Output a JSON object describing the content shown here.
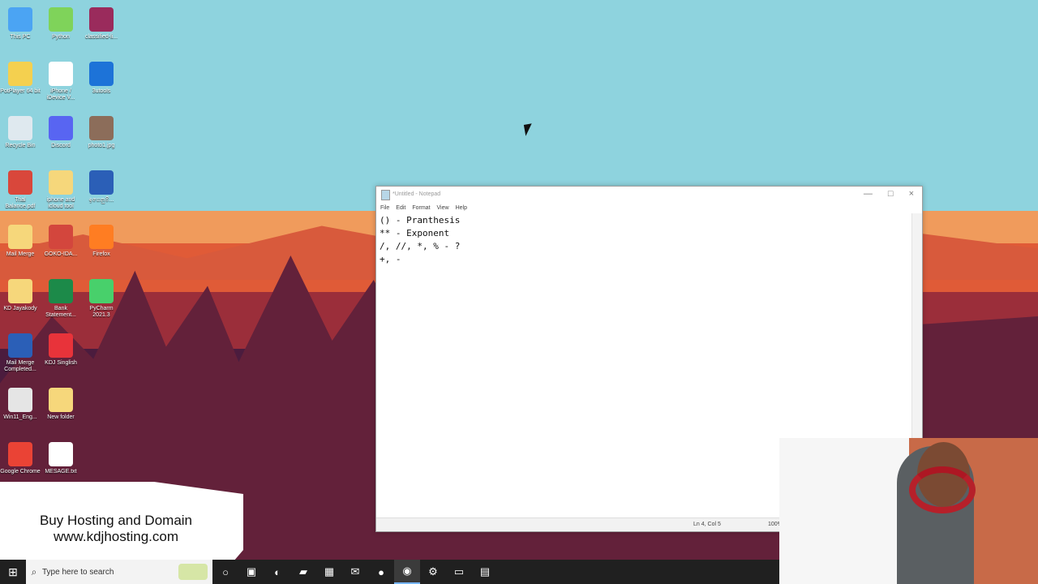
{
  "desktop": {
    "icons": [
      {
        "label": "This PC",
        "icon": "computer-icon",
        "color": "#4ba4f3"
      },
      {
        "label": "Python",
        "icon": "pycharm-icon",
        "color": "#7fd35a"
      },
      {
        "label": "classified-li...",
        "icon": "winrar-icon",
        "color": "#9a2b5c"
      },
      {
        "label": "PotPlayer 64 bit",
        "icon": "potplayer-icon",
        "color": "#f4d04f"
      },
      {
        "label": "iPhone / iDevice V...",
        "icon": "document-icon",
        "color": "#ffffff"
      },
      {
        "label": "3utools",
        "icon": "3utools-icon",
        "color": "#1d73d8"
      },
      {
        "label": "Recycle Bin",
        "icon": "recycle-bin-icon",
        "color": "#dfe9ef"
      },
      {
        "label": "Discord",
        "icon": "discord-icon",
        "color": "#5865f2"
      },
      {
        "label": "photo1.jpg",
        "icon": "photo-icon",
        "color": "#8c6d5a"
      },
      {
        "label": "Trial Balance.pdf",
        "icon": "pdf-icon",
        "color": "#d9473b"
      },
      {
        "label": "iphone and icloud tool",
        "icon": "folder-icon",
        "color": "#f6d77b"
      },
      {
        "label": "ඉගෙනුම්...",
        "icon": "word-icon",
        "color": "#2b5fb7"
      },
      {
        "label": "Mail Merge",
        "icon": "folder-icon",
        "color": "#f6d77b"
      },
      {
        "label": "GOKO-IDA...",
        "icon": "image-icon",
        "color": "#d3463d"
      },
      {
        "label": "Firefox",
        "icon": "firefox-icon",
        "color": "#ff7d22"
      },
      {
        "label": "KD Jayakody",
        "icon": "folder-icon",
        "color": "#f6d77b"
      },
      {
        "label": "Bank Statement...",
        "icon": "excel-icon",
        "color": "#1c8a49"
      },
      {
        "label": "PyCharm 2021.3",
        "icon": "pycharm-icon",
        "color": "#48d06b"
      },
      {
        "label": "Mail Merge Completed...",
        "icon": "word-icon",
        "color": "#2b5fb7"
      },
      {
        "label": "KDJ Singlish",
        "icon": "singlish-icon",
        "color": "#e8333a"
      },
      {
        "label": "",
        "icon": "blank-icon",
        "color": "transparent"
      },
      {
        "label": "Win11_Eng...",
        "icon": "iso-icon",
        "color": "#e5e5e5"
      },
      {
        "label": "New folder",
        "icon": "folder-icon",
        "color": "#f6d77b"
      },
      {
        "label": "",
        "icon": "blank-icon",
        "color": "transparent"
      },
      {
        "label": "Google Chrome",
        "icon": "chrome-icon",
        "color": "#ea4335"
      },
      {
        "label": "MESAGE.txt",
        "icon": "text-file-icon",
        "color": "#ffffff"
      }
    ]
  },
  "notepad": {
    "title": "*Untitled - Notepad",
    "menu": [
      "File",
      "Edit",
      "Format",
      "View",
      "Help"
    ],
    "lines": [
      "() - Pranthesis",
      "** - Exponent",
      "/, //, *, % - ?",
      "+, -"
    ],
    "status_position": "Ln 4, Col 5",
    "zoom": "100%"
  },
  "promo": {
    "line1": "Buy Hosting and Domain",
    "line2": "www.kdjhosting.com"
  },
  "taskbar": {
    "search_placeholder": "Type here to search",
    "icons": [
      {
        "name": "cortana-icon",
        "glyph": "○"
      },
      {
        "name": "task-view-icon",
        "glyph": "▣"
      },
      {
        "name": "edge-icon",
        "glyph": "◐"
      },
      {
        "name": "file-explorer-icon",
        "glyph": "▰"
      },
      {
        "name": "store-icon",
        "glyph": "▦"
      },
      {
        "name": "mail-icon",
        "glyph": "✉"
      },
      {
        "name": "firefox-icon",
        "glyph": "●"
      },
      {
        "name": "chrome-icon",
        "glyph": "◉"
      },
      {
        "name": "settings-icon",
        "glyph": "⚙"
      },
      {
        "name": "window-app-icon",
        "glyph": "▭"
      },
      {
        "name": "notepad-icon",
        "glyph": "▤"
      }
    ]
  }
}
